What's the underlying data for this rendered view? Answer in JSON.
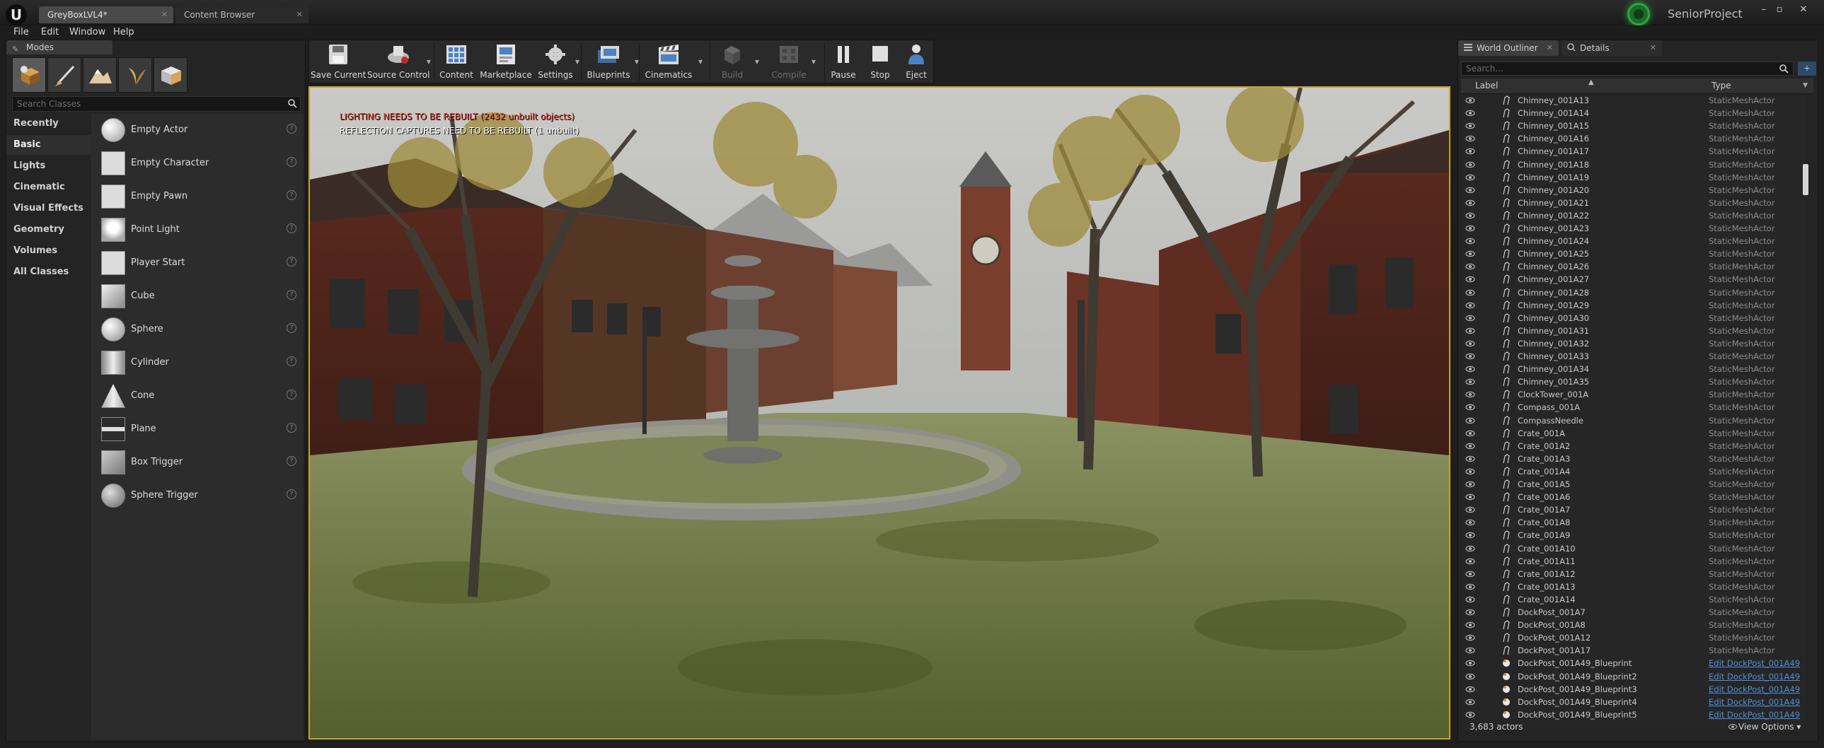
{
  "window": {
    "tabs": [
      {
        "label": "GreyBoxLVL4*"
      },
      {
        "label": "Content Browser"
      }
    ],
    "project_name": "SeniorProject",
    "controls": [
      "–",
      "▫",
      "✕"
    ]
  },
  "menu": [
    "File",
    "Edit",
    "Window",
    "Help"
  ],
  "modes": {
    "tab_label": "Modes",
    "search_placeholder": "Search Classes",
    "categories": [
      "Recently Placed",
      "Basic",
      "Lights",
      "Cinematic",
      "Visual Effects",
      "Geometry",
      "Volumes",
      "All Classes"
    ],
    "active_category": "Basic",
    "items": [
      {
        "label": "Empty Actor",
        "icon": "sphere-icon"
      },
      {
        "label": "Empty Character",
        "icon": "character-icon"
      },
      {
        "label": "Empty Pawn",
        "icon": "pawn-icon"
      },
      {
        "label": "Point Light",
        "icon": "light-bulb-icon"
      },
      {
        "label": "Player Start",
        "icon": "flag-icon"
      },
      {
        "label": "Cube",
        "icon": "cube-icon"
      },
      {
        "label": "Sphere",
        "icon": "sphere-icon"
      },
      {
        "label": "Cylinder",
        "icon": "cylinder-icon"
      },
      {
        "label": "Cone",
        "icon": "cone-icon"
      },
      {
        "label": "Plane",
        "icon": "plane-icon"
      },
      {
        "label": "Box Trigger",
        "icon": "box-trigger-icon"
      },
      {
        "label": "Sphere Trigger",
        "icon": "sphere-trigger-icon"
      }
    ]
  },
  "toolbar": {
    "buttons": [
      {
        "label": "Save Current",
        "enabled": true
      },
      {
        "label": "Source Control",
        "enabled": true
      },
      {
        "label": "Content",
        "enabled": true
      },
      {
        "label": "Marketplace",
        "enabled": true
      },
      {
        "label": "Settings",
        "enabled": true
      },
      {
        "label": "Blueprints",
        "enabled": true
      },
      {
        "label": "Cinematics",
        "enabled": true
      },
      {
        "label": "Build",
        "enabled": false
      },
      {
        "label": "Compile",
        "enabled": false
      },
      {
        "label": "Pause",
        "enabled": true
      },
      {
        "label": "Stop",
        "enabled": true
      },
      {
        "label": "Eject",
        "enabled": true
      }
    ]
  },
  "viewport": {
    "warning_lighting": "LIGHTING NEEDS TO BE REBUILT (2432 unbuilt objects)",
    "warning_reflection": "REFLECTION CAPTURES NEED TO BE REBUILT (1 unbuilt)"
  },
  "outliner": {
    "tab_outliner": "World Outliner",
    "tab_details": "Details",
    "search_placeholder": "Search...",
    "col_label": "Label",
    "col_type": "Type",
    "rows": [
      {
        "label": "Chimney_001A13",
        "type": "StaticMeshActor",
        "link": false
      },
      {
        "label": "Chimney_001A14",
        "type": "StaticMeshActor",
        "link": false
      },
      {
        "label": "Chimney_001A15",
        "type": "StaticMeshActor",
        "link": false
      },
      {
        "label": "Chimney_001A16",
        "type": "StaticMeshActor",
        "link": false
      },
      {
        "label": "Chimney_001A17",
        "type": "StaticMeshActor",
        "link": false
      },
      {
        "label": "Chimney_001A18",
        "type": "StaticMeshActor",
        "link": false
      },
      {
        "label": "Chimney_001A19",
        "type": "StaticMeshActor",
        "link": false
      },
      {
        "label": "Chimney_001A20",
        "type": "StaticMeshActor",
        "link": false
      },
      {
        "label": "Chimney_001A21",
        "type": "StaticMeshActor",
        "link": false
      },
      {
        "label": "Chimney_001A22",
        "type": "StaticMeshActor",
        "link": false
      },
      {
        "label": "Chimney_001A23",
        "type": "StaticMeshActor",
        "link": false
      },
      {
        "label": "Chimney_001A24",
        "type": "StaticMeshActor",
        "link": false
      },
      {
        "label": "Chimney_001A25",
        "type": "StaticMeshActor",
        "link": false
      },
      {
        "label": "Chimney_001A26",
        "type": "StaticMeshActor",
        "link": false
      },
      {
        "label": "Chimney_001A27",
        "type": "StaticMeshActor",
        "link": false
      },
      {
        "label": "Chimney_001A28",
        "type": "StaticMeshActor",
        "link": false
      },
      {
        "label": "Chimney_001A29",
        "type": "StaticMeshActor",
        "link": false
      },
      {
        "label": "Chimney_001A30",
        "type": "StaticMeshActor",
        "link": false
      },
      {
        "label": "Chimney_001A31",
        "type": "StaticMeshActor",
        "link": false
      },
      {
        "label": "Chimney_001A32",
        "type": "StaticMeshActor",
        "link": false
      },
      {
        "label": "Chimney_001A33",
        "type": "StaticMeshActor",
        "link": false
      },
      {
        "label": "Chimney_001A34",
        "type": "StaticMeshActor",
        "link": false
      },
      {
        "label": "Chimney_001A35",
        "type": "StaticMeshActor",
        "link": false
      },
      {
        "label": "ClockTower_001A",
        "type": "StaticMeshActor",
        "link": false
      },
      {
        "label": "Compass_001A",
        "type": "StaticMeshActor",
        "link": false
      },
      {
        "label": "CompassNeedle",
        "type": "StaticMeshActor",
        "link": false
      },
      {
        "label": "Crate_001A",
        "type": "StaticMeshActor",
        "link": false
      },
      {
        "label": "Crate_001A2",
        "type": "StaticMeshActor",
        "link": false
      },
      {
        "label": "Crate_001A3",
        "type": "StaticMeshActor",
        "link": false
      },
      {
        "label": "Crate_001A4",
        "type": "StaticMeshActor",
        "link": false
      },
      {
        "label": "Crate_001A5",
        "type": "StaticMeshActor",
        "link": false
      },
      {
        "label": "Crate_001A6",
        "type": "StaticMeshActor",
        "link": false
      },
      {
        "label": "Crate_001A7",
        "type": "StaticMeshActor",
        "link": false
      },
      {
        "label": "Crate_001A8",
        "type": "StaticMeshActor",
        "link": false
      },
      {
        "label": "Crate_001A9",
        "type": "StaticMeshActor",
        "link": false
      },
      {
        "label": "Crate_001A10",
        "type": "StaticMeshActor",
        "link": false
      },
      {
        "label": "Crate_001A11",
        "type": "StaticMeshActor",
        "link": false
      },
      {
        "label": "Crate_001A12",
        "type": "StaticMeshActor",
        "link": false
      },
      {
        "label": "Crate_001A13",
        "type": "StaticMeshActor",
        "link": false
      },
      {
        "label": "Crate_001A14",
        "type": "StaticMeshActor",
        "link": false
      },
      {
        "label": "DockPost_001A7",
        "type": "StaticMeshActor",
        "link": false
      },
      {
        "label": "DockPost_001A8",
        "type": "StaticMeshActor",
        "link": false
      },
      {
        "label": "DockPost_001A12",
        "type": "StaticMeshActor",
        "link": false
      },
      {
        "label": "DockPost_001A17",
        "type": "StaticMeshActor",
        "link": false
      },
      {
        "label": "DockPost_001A49_Blueprint",
        "type": "Edit DockPost_001A49",
        "link": true
      },
      {
        "label": "DockPost_001A49_Blueprint2",
        "type": "Edit DockPost_001A49",
        "link": true
      },
      {
        "label": "DockPost_001A49_Blueprint3",
        "type": "Edit DockPost_001A49",
        "link": true
      },
      {
        "label": "DockPost_001A49_Blueprint4",
        "type": "Edit DockPost_001A49",
        "link": true
      },
      {
        "label": "DockPost_001A49_Blueprint5",
        "type": "Edit DockPost_001A49",
        "link": true
      }
    ],
    "actor_count": "3,683 actors",
    "view_options": "View Options ▾"
  },
  "colors": {
    "accent_viewport_border": "#c7a22a",
    "warning_red": "#e23b2c",
    "link_blue": "#4e8fd8",
    "project_green": "#2fa33d"
  }
}
